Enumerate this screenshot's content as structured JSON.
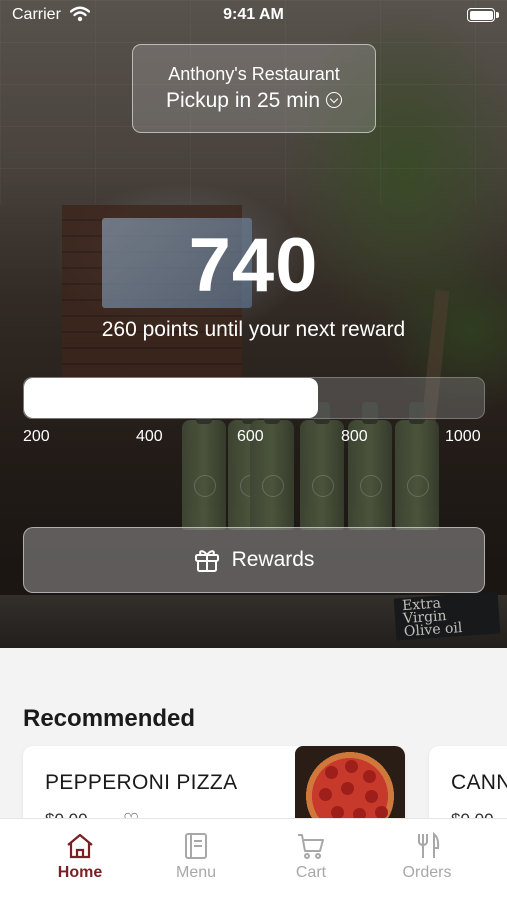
{
  "status_bar": {
    "carrier": "Carrier",
    "time": "9:41 AM"
  },
  "restaurant": {
    "name": "Anthony's Restaurant",
    "pickup": "Pickup in 25 min"
  },
  "loyalty": {
    "points": "740",
    "until_text": "260 points until your next reward",
    "progress_fraction": 0.64,
    "ticks": [
      "200",
      "400",
      "600",
      "800",
      "1000"
    ],
    "rewards_button": "Rewards"
  },
  "sign": {
    "line1": "Extra",
    "line2": "Virgin",
    "line3": "Olive oil"
  },
  "recommended": {
    "title": "Recommended",
    "items": [
      {
        "name": "PEPPERONI PIZZA",
        "price": "$0.00"
      },
      {
        "name": "CANN",
        "price": "$0.00"
      }
    ]
  },
  "tabs": [
    {
      "label": "Home",
      "icon": "home-icon",
      "active": true
    },
    {
      "label": "Menu",
      "icon": "menu-book-icon",
      "active": false
    },
    {
      "label": "Cart",
      "icon": "cart-icon",
      "active": false
    },
    {
      "label": "Orders",
      "icon": "fork-knife-icon",
      "active": false
    }
  ],
  "colors": {
    "accent": "#7a1f22",
    "inactive_tab": "#a8a8a8"
  }
}
